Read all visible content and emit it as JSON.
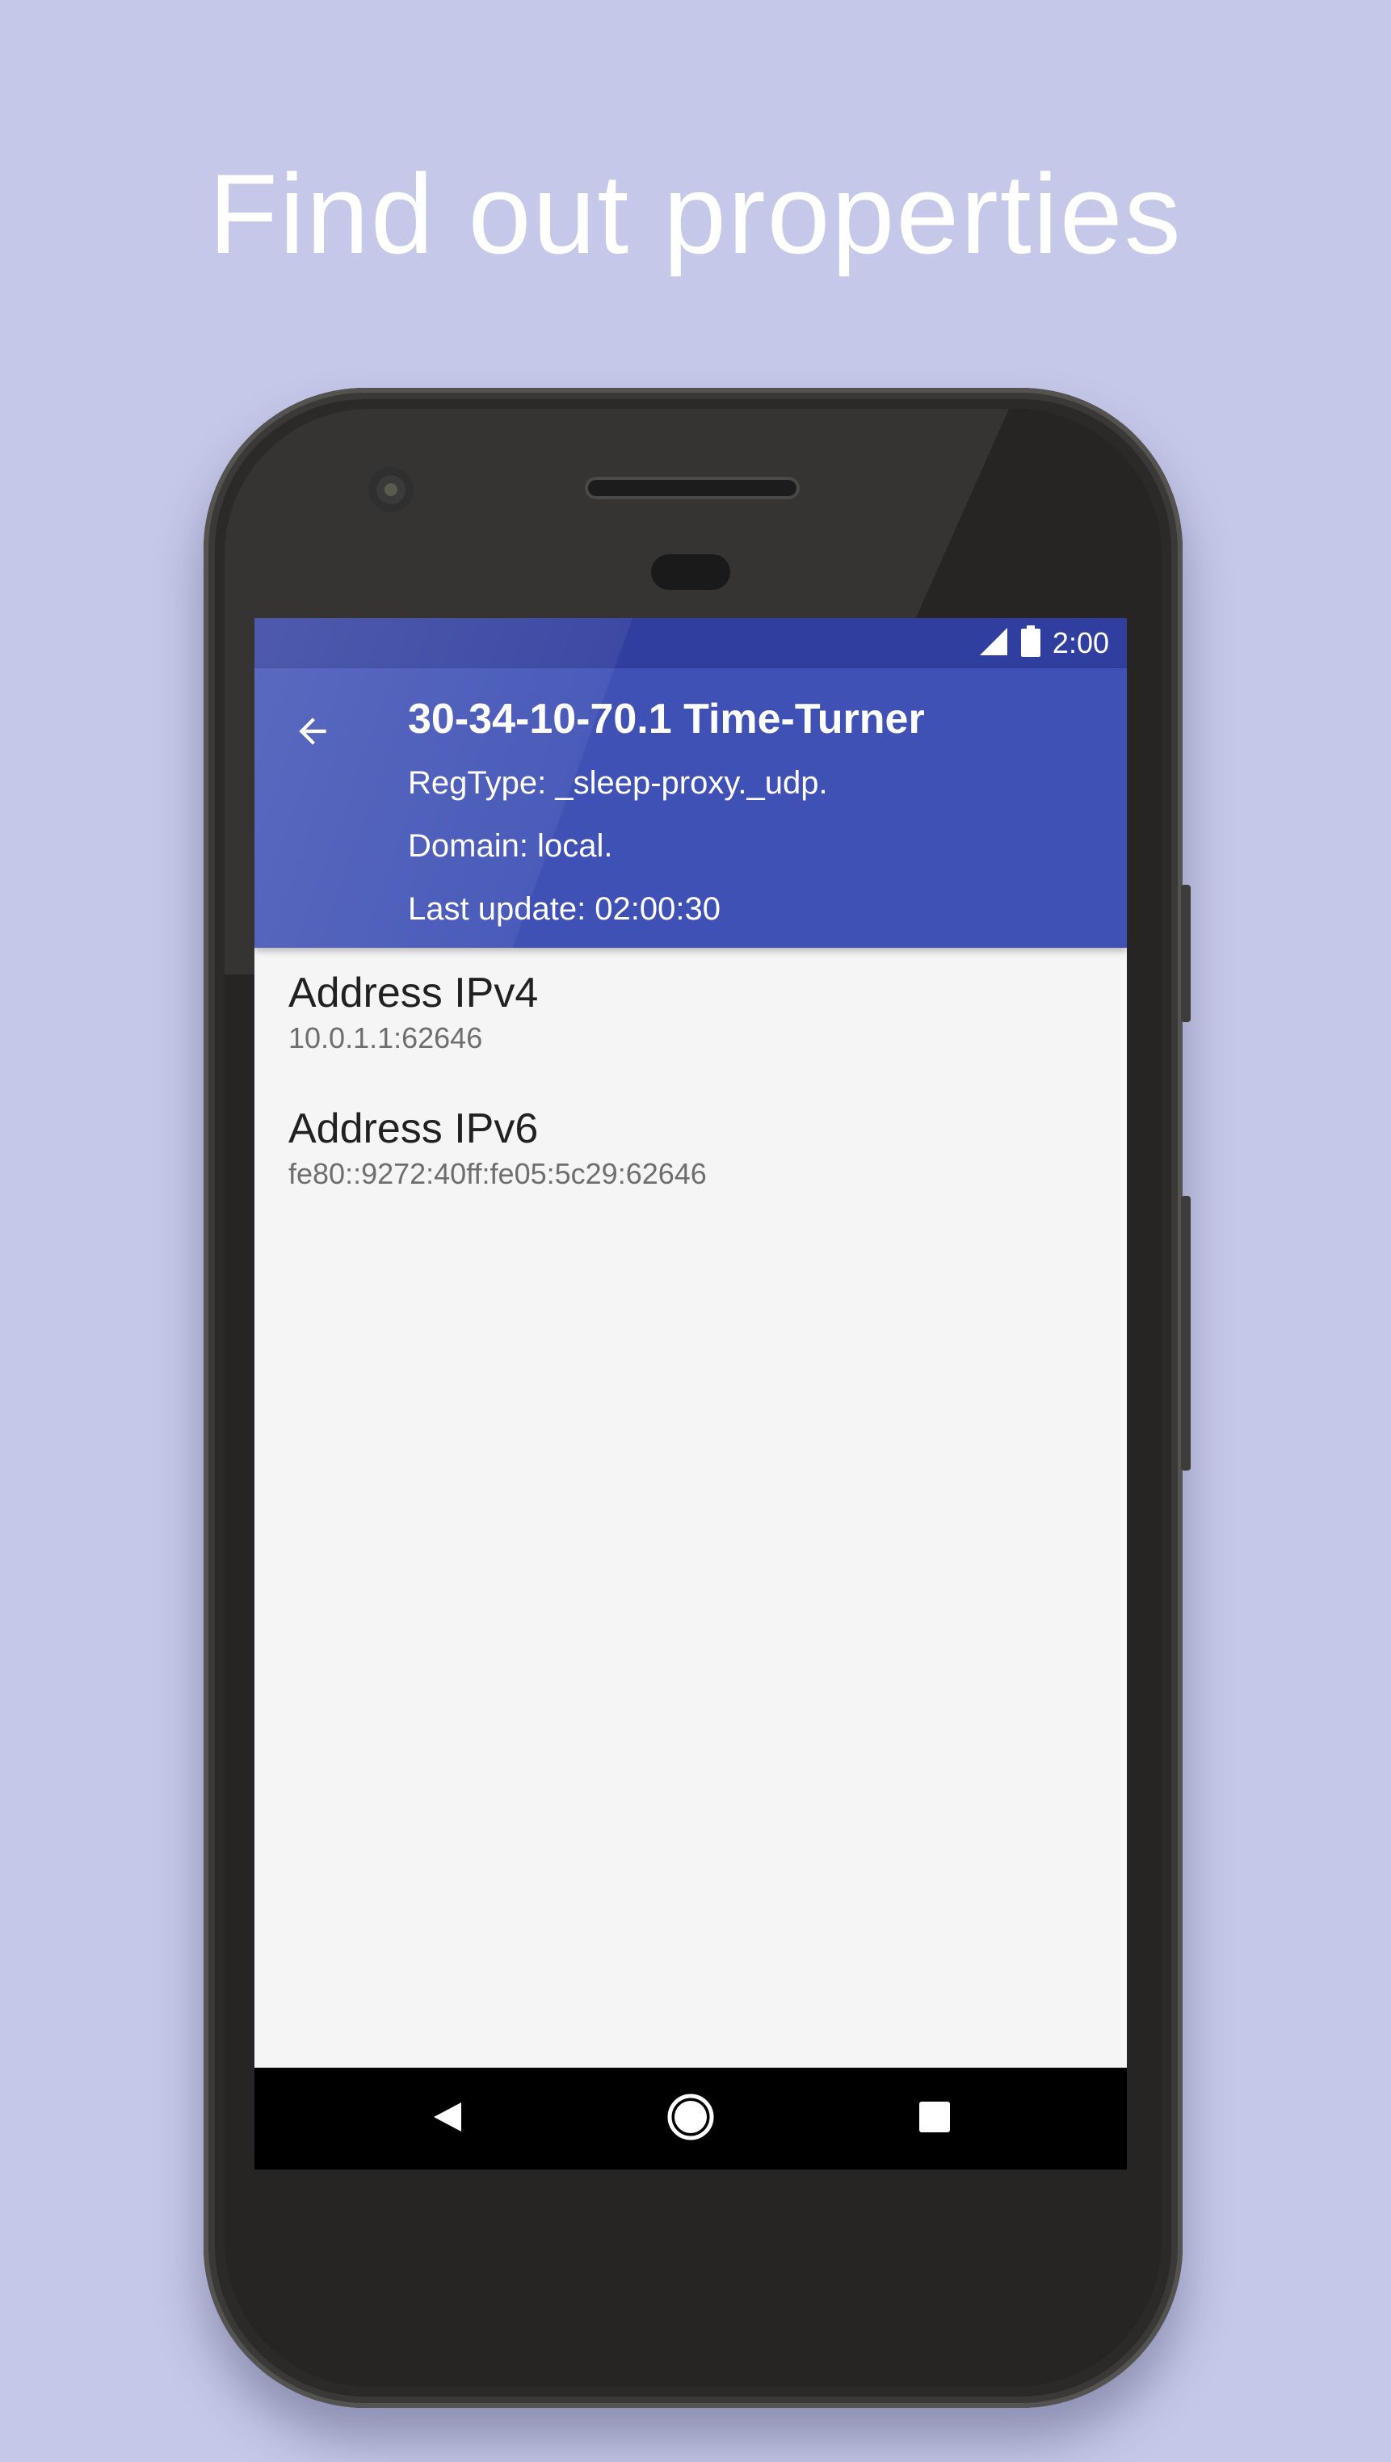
{
  "headline": "Find out properties",
  "status_bar": {
    "time": "2:00",
    "icons": [
      "signal-icon",
      "battery-icon"
    ]
  },
  "app_bar": {
    "back_icon": "arrow-back-icon",
    "title": "30-34-10-70.1 Time-Turner",
    "regtype": "RegType: _sleep-proxy._udp.",
    "domain": "Domain: local.",
    "last_update": "Last update: 02:00:30",
    "color": "#3f51b5"
  },
  "properties": [
    {
      "label": "Address IPv4",
      "value": "10.0.1.1:62646"
    },
    {
      "label": "Address IPv6",
      "value": "fe80::9272:40ff:fe05:5c29:62646"
    }
  ],
  "nav_bar": {
    "buttons": [
      "back-nav-icon",
      "home-nav-icon",
      "recents-nav-icon"
    ]
  },
  "colors": {
    "background": "#c5c8e8",
    "primary": "#3f51b5",
    "primary_dark": "#303f9f"
  }
}
